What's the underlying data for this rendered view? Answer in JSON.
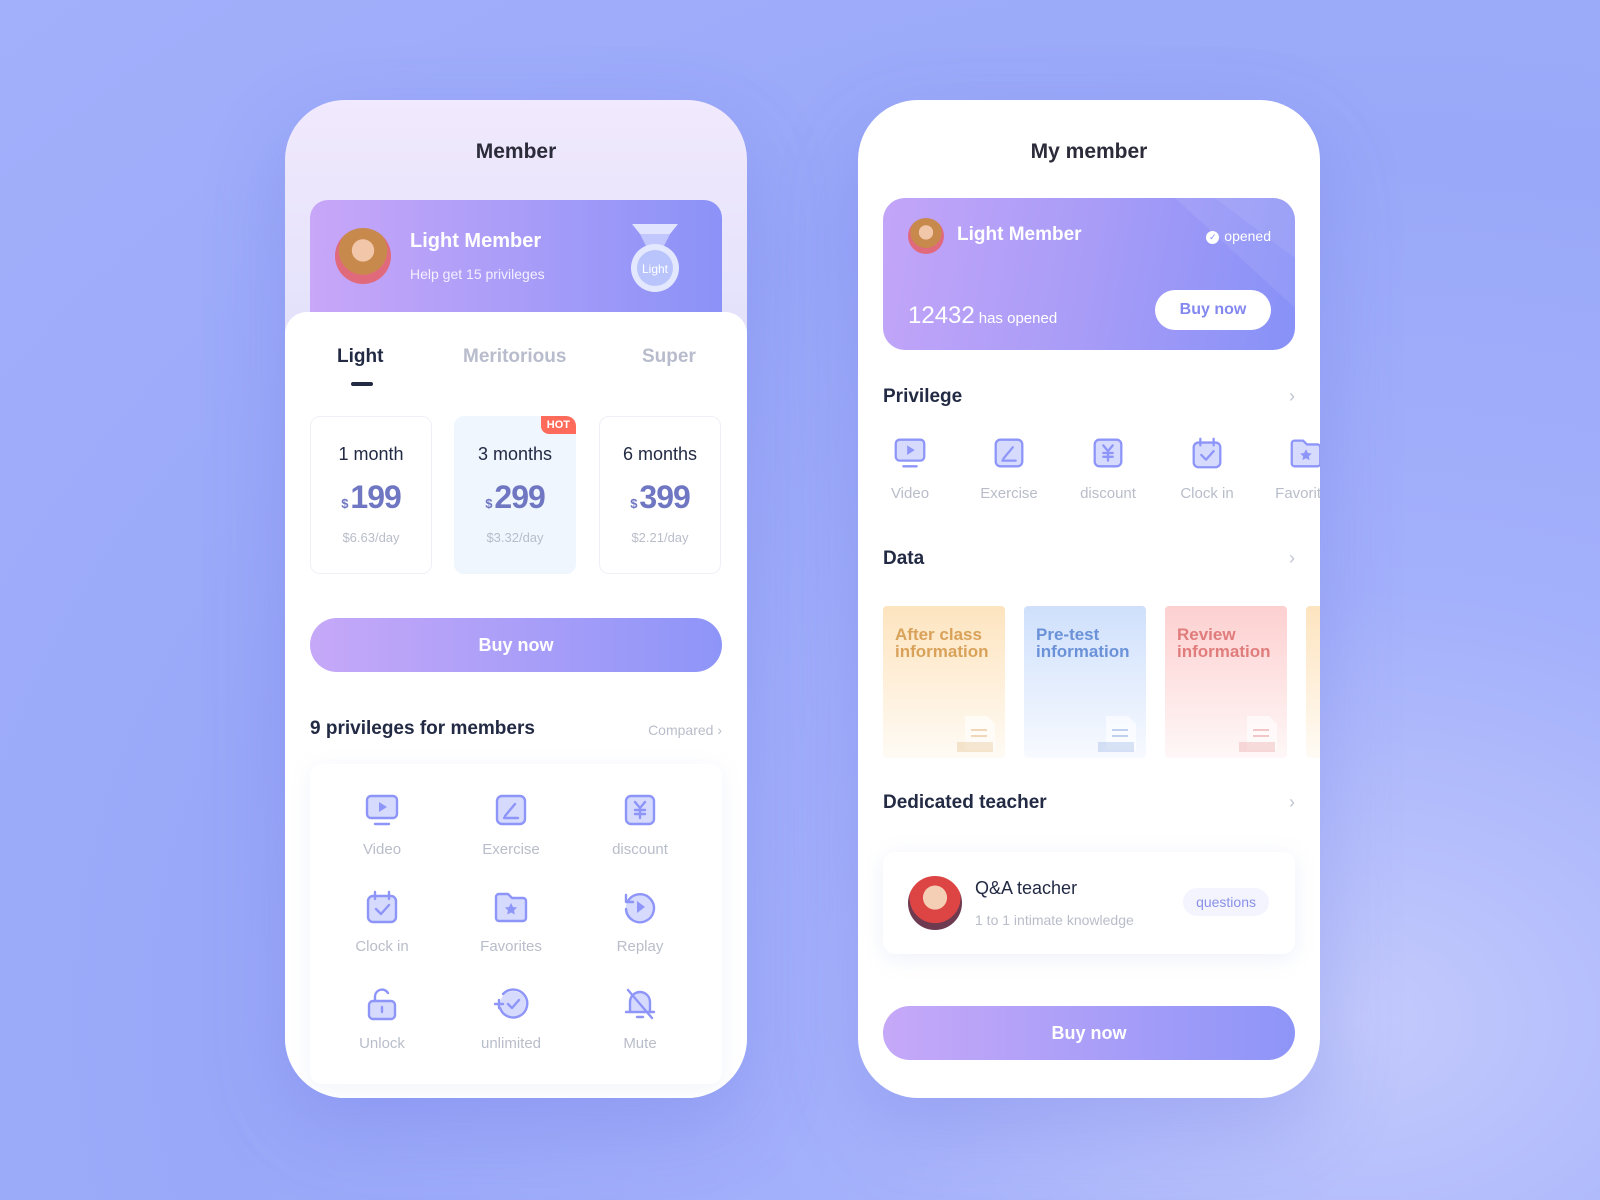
{
  "colors": {
    "accent": "#8e95f8",
    "accent_light": "#c6a8f8",
    "hot": "#ff6b5b",
    "text_dark": "#222a44",
    "text_muted": "#b8bdc9"
  },
  "member": {
    "title": "Member",
    "card": {
      "name": "Light Member",
      "subtitle": "Help get 15 privileges",
      "medal_label": "Light"
    },
    "tabs": [
      {
        "label": "Light",
        "active": true
      },
      {
        "label": "Meritorious",
        "active": false
      },
      {
        "label": "Super",
        "active": false
      }
    ],
    "plans": [
      {
        "duration": "1 month",
        "currency": "$",
        "price": "199",
        "per_day": "$6.63/day",
        "selected": false
      },
      {
        "duration": "3 months",
        "currency": "$",
        "price": "299",
        "per_day": "$3.32/day",
        "selected": true,
        "badge": "HOT"
      },
      {
        "duration": "6 months",
        "currency": "$",
        "price": "399",
        "per_day": "$2.21/day",
        "selected": false
      }
    ],
    "buy_label": "Buy now",
    "privileges_title": "9 privileges for members",
    "compared_label": "Compared",
    "privileges": [
      {
        "label": "Video",
        "icon": "video-icon"
      },
      {
        "label": "Exercise",
        "icon": "exercise-icon"
      },
      {
        "label": "discount",
        "icon": "discount-icon"
      },
      {
        "label": "Clock in",
        "icon": "clock-in-icon"
      },
      {
        "label": "Favorites",
        "icon": "favorites-icon"
      },
      {
        "label": "Replay",
        "icon": "replay-icon"
      },
      {
        "label": "Unlock",
        "icon": "unlock-icon"
      },
      {
        "label": "unlimited",
        "icon": "unlimited-icon"
      },
      {
        "label": "Mute",
        "icon": "mute-icon"
      }
    ]
  },
  "my_member": {
    "title": "My member",
    "card": {
      "name": "Light Member",
      "status": "opened",
      "count": "12432",
      "count_label": "has opened",
      "buy_label": "Buy now"
    },
    "privilege_title": "Privilege",
    "privileges": [
      {
        "label": "Video",
        "icon": "video-icon"
      },
      {
        "label": "Exercise",
        "icon": "exercise-icon"
      },
      {
        "label": "discount",
        "icon": "discount-icon"
      },
      {
        "label": "Clock in",
        "icon": "clock-in-icon"
      },
      {
        "label": "Favorites",
        "icon": "favorites-icon"
      }
    ],
    "data_title": "Data",
    "data_cards": [
      {
        "line1": "After class",
        "line2": "information",
        "bg": "#fde4bf",
        "fg": "#d9a25a"
      },
      {
        "line1": "Pre-test",
        "line2": "information",
        "bg": "#cfe0fc",
        "fg": "#6b92d8"
      },
      {
        "line1": "Review",
        "line2": "information",
        "bg": "#fdd0d0",
        "fg": "#e07c7c"
      },
      {
        "line1": "",
        "line2": "",
        "bg": "#fde4bf",
        "fg": "#d9a25a"
      }
    ],
    "teacher_title": "Dedicated teacher",
    "teacher": {
      "name": "Q&A teacher",
      "subtitle": "1 to 1 intimate knowledge",
      "badge": "questions"
    },
    "buy_label": "Buy now"
  }
}
